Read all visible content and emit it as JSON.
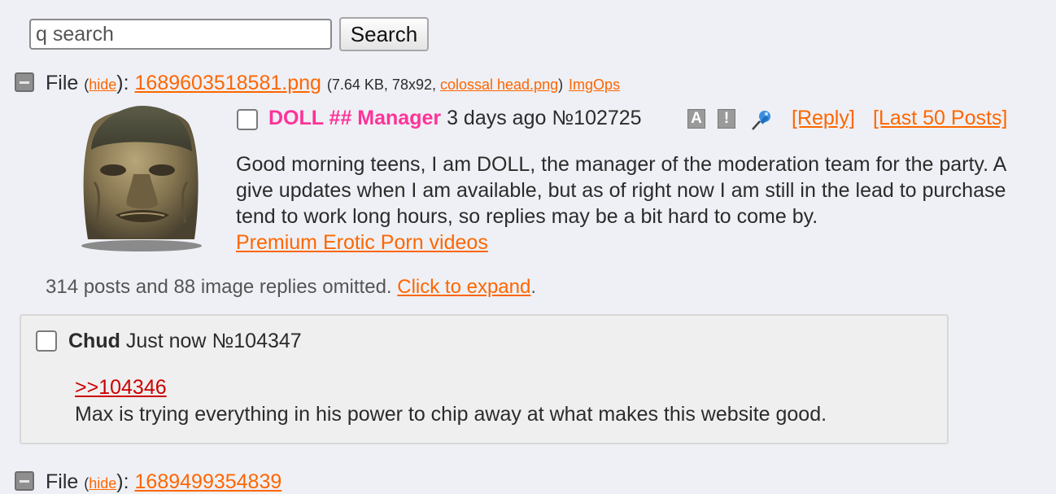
{
  "search": {
    "placeholder": "q search",
    "button_label": "Search"
  },
  "file": {
    "label": "File",
    "hide_label": "hide",
    "filename": "1689603518581.png",
    "meta_prefix": "(7.64 KB, 78x92, ",
    "original_name": "colossal head.png",
    "meta_suffix": ")",
    "imgops": "ImgOps"
  },
  "op": {
    "name": "DOLL ## Manager",
    "time": "3 days ago",
    "post_no": "№102725",
    "badge_a": "A",
    "badge_excl": "!",
    "reply_link": "[Reply]",
    "last50_link": "[Last 50 Posts]",
    "body_lines": [
      "Good morning teens, I am DOLL, the manager of the moderation team for the party. A",
      "give updates when I am available, but as of right now I am still in the lead to purchase",
      "tend to work long hours, so replies may be a bit hard to come by."
    ],
    "promo_link": "Premium Erotic Porn videos"
  },
  "omitted": {
    "text": "314 posts and 88 image replies omitted. ",
    "link": "Click to expand",
    "suffix": "."
  },
  "reply": {
    "name": "Chud",
    "time": "Just now",
    "post_no": "№104347",
    "quote": ">>104346",
    "text": "Max is trying everything in his power to chip away at what makes this website good."
  },
  "next_file": {
    "label": "File",
    "hide_label": "hide",
    "filename": "1689499354839"
  }
}
